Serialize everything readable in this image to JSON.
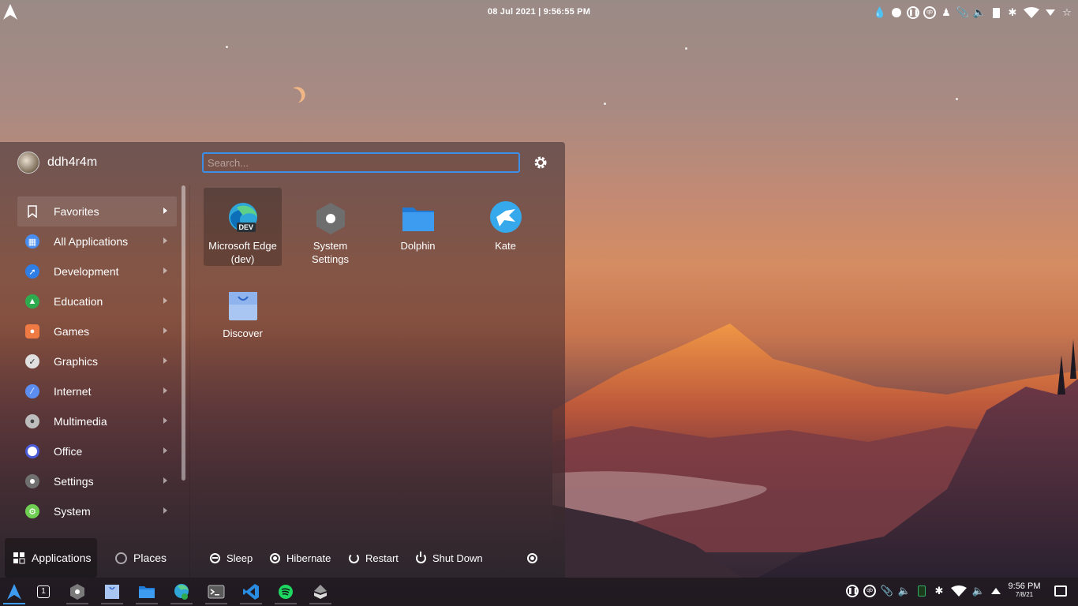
{
  "top_panel": {
    "clock": "08 Jul 2021 | 9:56:55 PM",
    "tray_icons": [
      "drop-icon",
      "record-icon",
      "pause-icon",
      "qbittorrent-icon",
      "user-icon",
      "attachment-icon",
      "volume-icon",
      "battery-icon",
      "bluetooth-icon",
      "wifi-icon",
      "dropdown-icon",
      "star-icon"
    ]
  },
  "launcher": {
    "username": "ddh4r4m",
    "search_placeholder": "Search...",
    "categories": [
      {
        "label": "Favorites",
        "icon": "bookmark-icon",
        "color": "#ffffff"
      },
      {
        "label": "All Applications",
        "icon": "grid-icon",
        "color": "#4a8df0"
      },
      {
        "label": "Development",
        "icon": "hammer-icon",
        "color": "#2f7ee6"
      },
      {
        "label": "Education",
        "icon": "graduation-icon",
        "color": "#2eaa4f"
      },
      {
        "label": "Games",
        "icon": "gamepad-icon",
        "color": "#f07a44"
      },
      {
        "label": "Graphics",
        "icon": "palette-icon",
        "color": "#e0e0e0"
      },
      {
        "label": "Internet",
        "icon": "globe-icon",
        "color": "#5b8ef0"
      },
      {
        "label": "Multimedia",
        "icon": "speaker-icon",
        "color": "#bdbdbd"
      },
      {
        "label": "Office",
        "icon": "document-icon",
        "color": "#4a5bd8"
      },
      {
        "label": "Settings",
        "icon": "gear-icon",
        "color": "#707070"
      },
      {
        "label": "System",
        "icon": "system-icon",
        "color": "#6fcf52"
      }
    ],
    "apps": [
      {
        "label_1": "Microsoft Edge",
        "label_2": "(dev)",
        "icon": "edge-dev-icon",
        "badge": "DEV"
      },
      {
        "label_1": "System",
        "label_2": "Settings",
        "icon": "system-settings-icon"
      },
      {
        "label_1": "Dolphin",
        "label_2": "",
        "icon": "dolphin-icon"
      },
      {
        "label_1": "Kate",
        "label_2": "",
        "icon": "kate-icon"
      },
      {
        "label_1": "Discover",
        "label_2": "",
        "icon": "discover-icon"
      }
    ],
    "tabs": {
      "applications": "Applications",
      "places": "Places"
    },
    "power": {
      "sleep": "Sleep",
      "hibernate": "Hibernate",
      "restart": "Restart",
      "shutdown": "Shut Down"
    }
  },
  "taskbar": {
    "pager": "1",
    "clock_time": "9:56 PM",
    "clock_date": "7/8/21"
  }
}
